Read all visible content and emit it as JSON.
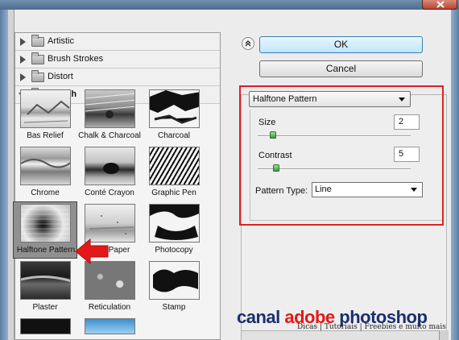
{
  "gallery": {
    "categories": [
      {
        "label": "Artistic",
        "expanded": false
      },
      {
        "label": "Brush Strokes",
        "expanded": false
      },
      {
        "label": "Distort",
        "expanded": false
      },
      {
        "label": "Sketch",
        "expanded": true
      }
    ],
    "thumbnails": [
      {
        "label": "Bas Relief",
        "selected": false
      },
      {
        "label": "Chalk & Charcoal",
        "selected": false
      },
      {
        "label": "Charcoal",
        "selected": false
      },
      {
        "label": "Chrome",
        "selected": false
      },
      {
        "label": "Conté Crayon",
        "selected": false
      },
      {
        "label": "Graphic Pen",
        "selected": false
      },
      {
        "label": "Halftone Pattern",
        "selected": true
      },
      {
        "label": "Note Paper",
        "selected": false
      },
      {
        "label": "Photocopy",
        "selected": false
      },
      {
        "label": "Plaster",
        "selected": false
      },
      {
        "label": "Reticulation",
        "selected": false
      },
      {
        "label": "Stamp",
        "selected": false
      }
    ]
  },
  "buttons": {
    "collapse": "⌃",
    "ok": "OK",
    "cancel": "Cancel"
  },
  "settings": {
    "filter_name": "Halftone Pattern",
    "size": {
      "label": "Size",
      "value": "2",
      "fraction": 0.08
    },
    "contrast": {
      "label": "Contrast",
      "value": "5",
      "fraction": 0.1
    },
    "pattern_type": {
      "label": "Pattern Type:",
      "value": "Line"
    }
  },
  "watermark": {
    "title_part1": "canal ",
    "title_accent": "adobe",
    "title_part2": " photoshop",
    "subtitle": "Dicas | Tutoriais | Freebies e muito mais"
  },
  "colors": {
    "highlight": "#e02020",
    "arrow": "#e31818",
    "slider_thumb": "#3c9a3c",
    "brand_blue": "#1a2f6f"
  }
}
